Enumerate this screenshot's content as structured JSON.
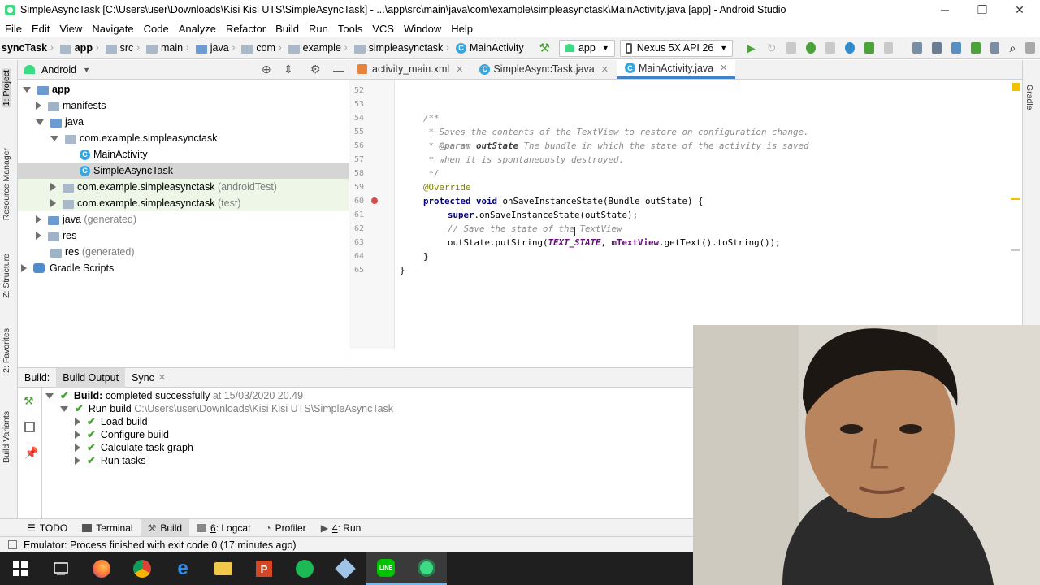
{
  "window": {
    "title": "SimpleAsyncTask [C:\\Users\\user\\Downloads\\Kisi Kisi UTS\\SimpleAsyncTask] - ...\\app\\src\\main\\java\\com\\example\\simpleasynctask\\MainActivity.java [app] - Android Studio",
    "minimize": "─",
    "restore": "❐",
    "close": "✕"
  },
  "menu": [
    "File",
    "Edit",
    "View",
    "Navigate",
    "Code",
    "Analyze",
    "Refactor",
    "Build",
    "Run",
    "Tools",
    "VCS",
    "Window",
    "Help"
  ],
  "breadcrumb": [
    "syncTask",
    "app",
    "src",
    "main",
    "java",
    "com",
    "example",
    "simpleasynctask",
    "MainActivity"
  ],
  "toolbar": {
    "run_config": "app",
    "device": "Nexus 5X API 26"
  },
  "project": {
    "view": "Android",
    "tree": [
      {
        "label": "app",
        "suffix": ""
      },
      {
        "label": "manifests",
        "suffix": ""
      },
      {
        "label": "java",
        "suffix": ""
      },
      {
        "label": "com.example.simpleasynctask",
        "suffix": ""
      },
      {
        "label": "MainActivity",
        "suffix": ""
      },
      {
        "label": "SimpleAsyncTask",
        "suffix": ""
      },
      {
        "label": "com.example.simpleasynctask",
        "suffix": "(androidTest)"
      },
      {
        "label": "com.example.simpleasynctask",
        "suffix": "(test)"
      },
      {
        "label": "java",
        "suffix": "(generated)"
      },
      {
        "label": "res",
        "suffix": ""
      },
      {
        "label": "res",
        "suffix": "(generated)"
      },
      {
        "label": "Gradle Scripts",
        "suffix": ""
      }
    ]
  },
  "editor": {
    "tabs": [
      "activity_main.xml",
      "SimpleAsyncTask.java",
      "MainActivity.java"
    ],
    "line_numbers": [
      "52",
      "53",
      "54",
      "55",
      "56",
      "57",
      "58",
      "59",
      "60",
      "61",
      "62",
      "63",
      "64",
      "65"
    ],
    "code": {
      "l54": "/**",
      "l55": " * Saves the contents of the TextView to restore on configuration change.",
      "l56a": " * ",
      "l56b": "@param",
      "l56c": " outState",
      "l56d": " The bundle in which the state of the activity is saved",
      "l57": " * when it is spontaneously destroyed.",
      "l58": " */",
      "l59": "@Override",
      "l60a": "protected void",
      "l60b": " onSaveInstanceState(Bundle outState) {",
      "l61a": "super",
      "l61b": ".onSaveInstanceState(outState);",
      "l62": "// Save the state of the TextView",
      "l63a": "outState.putString(",
      "l63b": "TEXT_STATE",
      "l63c": ", ",
      "l63d": "mTextView",
      "l63e": ".getText().toString());",
      "l64": "}",
      "l65": "}"
    }
  },
  "sidebar_tabs": {
    "left": [
      "1: Project",
      "Resource Manager",
      "Z: Structure",
      "2: Favorites",
      "Build Variants"
    ],
    "right": [
      "Gradle"
    ]
  },
  "build": {
    "tabs": [
      "Build:",
      "Build Output",
      "Sync"
    ],
    "summary_label": "Build:",
    "summary_text": "completed successfully",
    "summary_time": "at 15/03/2020 20.49",
    "run_build": "Run build",
    "run_build_path": "C:\\Users\\user\\Downloads\\Kisi Kisi UTS\\SimpleAsyncTask",
    "steps": [
      "Load build",
      "Configure build",
      "Calculate task graph",
      "Run tasks"
    ]
  },
  "tool_windows": [
    {
      "key": "",
      "label": "TODO"
    },
    {
      "key": "",
      "label": "Terminal"
    },
    {
      "key": "",
      "label": "Build"
    },
    {
      "key": "6",
      "label": ": Logcat"
    },
    {
      "key": "",
      "label": "Profiler"
    },
    {
      "key": "4",
      "label": ": Run"
    }
  ],
  "status": "Emulator: Process finished with exit code 0 (17 minutes ago)"
}
